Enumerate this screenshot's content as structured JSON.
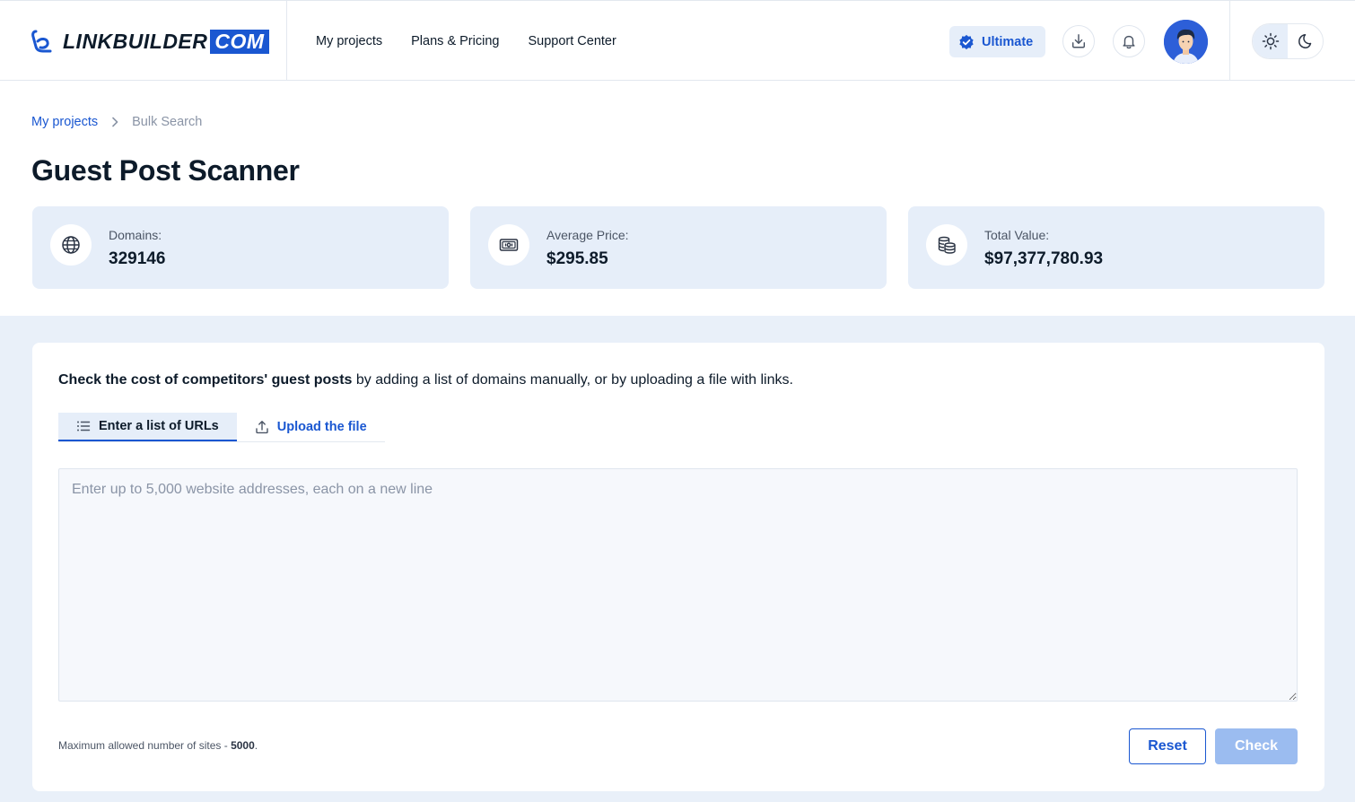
{
  "app": {
    "logo_text": "LINKBUILDER",
    "logo_suffix": "COM"
  },
  "nav": {
    "items": [
      "My projects",
      "Plans & Pricing",
      "Support Center"
    ]
  },
  "header": {
    "plan_badge": "Ultimate",
    "icons": [
      "download-icon",
      "bell-icon",
      "avatar",
      "sun-icon",
      "moon-icon"
    ],
    "theme_active": "light"
  },
  "breadcrumb": {
    "parent": "My projects",
    "current": "Bulk Search"
  },
  "page": {
    "title": "Guest Post Scanner"
  },
  "stats": [
    {
      "label": "Domains:",
      "value": "329146",
      "icon": "globe-icon"
    },
    {
      "label": "Average Price:",
      "value": "$295.85",
      "icon": "banknote-icon"
    },
    {
      "label": "Total Value:",
      "value": "$97,377,780.93",
      "icon": "coins-icon"
    }
  ],
  "form": {
    "intro_bold": "Check the cost of competitors' guest posts",
    "intro_rest": " by adding a list of domains manually, or by uploading a file with links.",
    "tabs": [
      {
        "label": "Enter a list of URLs",
        "active": true,
        "icon": "list-icon"
      },
      {
        "label": "Upload the file",
        "active": false,
        "icon": "upload-icon"
      }
    ],
    "textarea_value": "",
    "textarea_placeholder": "Enter up to 5,000 website addresses, each on a new line",
    "note_text": "Maximum allowed number of sites - ",
    "note_limit": "5000",
    "note_end": ".",
    "reset_label": "Reset",
    "check_label": "Check"
  },
  "colors": {
    "accent": "#1a57d1",
    "card_bg": "#e6eef9",
    "lower_bg": "#e9f0f9",
    "check_disabled": "#9bbcf0"
  }
}
